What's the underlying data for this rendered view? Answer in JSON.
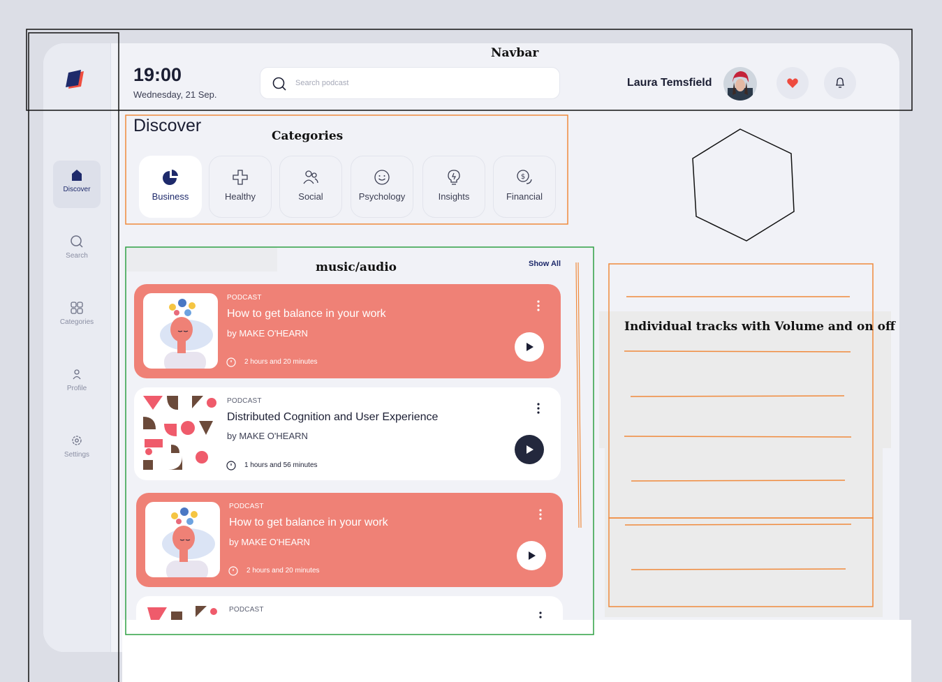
{
  "annotations": {
    "navbar": "Navbar",
    "categories": "Categories",
    "music_audio": "music/audio",
    "tracks": "Individual tracks with Volume and on off"
  },
  "header": {
    "time": "19:00",
    "date": "Wednesday, 21 Sep.",
    "search_placeholder": "Search podcast",
    "user_name": "Laura Temsfield"
  },
  "sidebar": {
    "items": [
      {
        "label": "Discover",
        "icon": "home-icon",
        "active": true
      },
      {
        "label": "Search",
        "icon": "search-icon"
      },
      {
        "label": "Categories",
        "icon": "grid-icon"
      },
      {
        "label": "Profile",
        "icon": "user-icon"
      },
      {
        "label": "Settings",
        "icon": "gear-icon"
      }
    ]
  },
  "discover": {
    "title": "Discover",
    "categories": [
      {
        "label": "Business",
        "icon": "pie-chart-icon"
      },
      {
        "label": "Healthy",
        "icon": "plus-icon"
      },
      {
        "label": "Social",
        "icon": "people-icon"
      },
      {
        "label": "Psychology",
        "icon": "smile-icon"
      },
      {
        "label": "Insights",
        "icon": "lightbulb-icon"
      },
      {
        "label": "Financial",
        "icon": "coins-icon"
      }
    ]
  },
  "podcasts": {
    "show_all": "Show All",
    "items": [
      {
        "tag": "PODCAST",
        "title": "How to get balance in your work",
        "author": "by MAKE O'HEARN",
        "duration": "2 hours and 20 minutes",
        "style": "red"
      },
      {
        "tag": "PODCAST",
        "title": "Distributed Cognition and User Experience",
        "author": "by MAKE O'HEARN",
        "duration": "1 hours and 56 minutes",
        "style": "white"
      },
      {
        "tag": "PODCAST",
        "title": "How to get balance in your work",
        "author": "by MAKE O'HEARN",
        "duration": "2 hours and 20 minutes",
        "style": "red"
      },
      {
        "tag": "PODCAST",
        "style": "white"
      }
    ]
  },
  "colors": {
    "accent_red": "#ef8176",
    "brand_navy": "#1e2a6b",
    "annotation_orange": "#f08a3c",
    "annotation_green": "#2ea043"
  }
}
